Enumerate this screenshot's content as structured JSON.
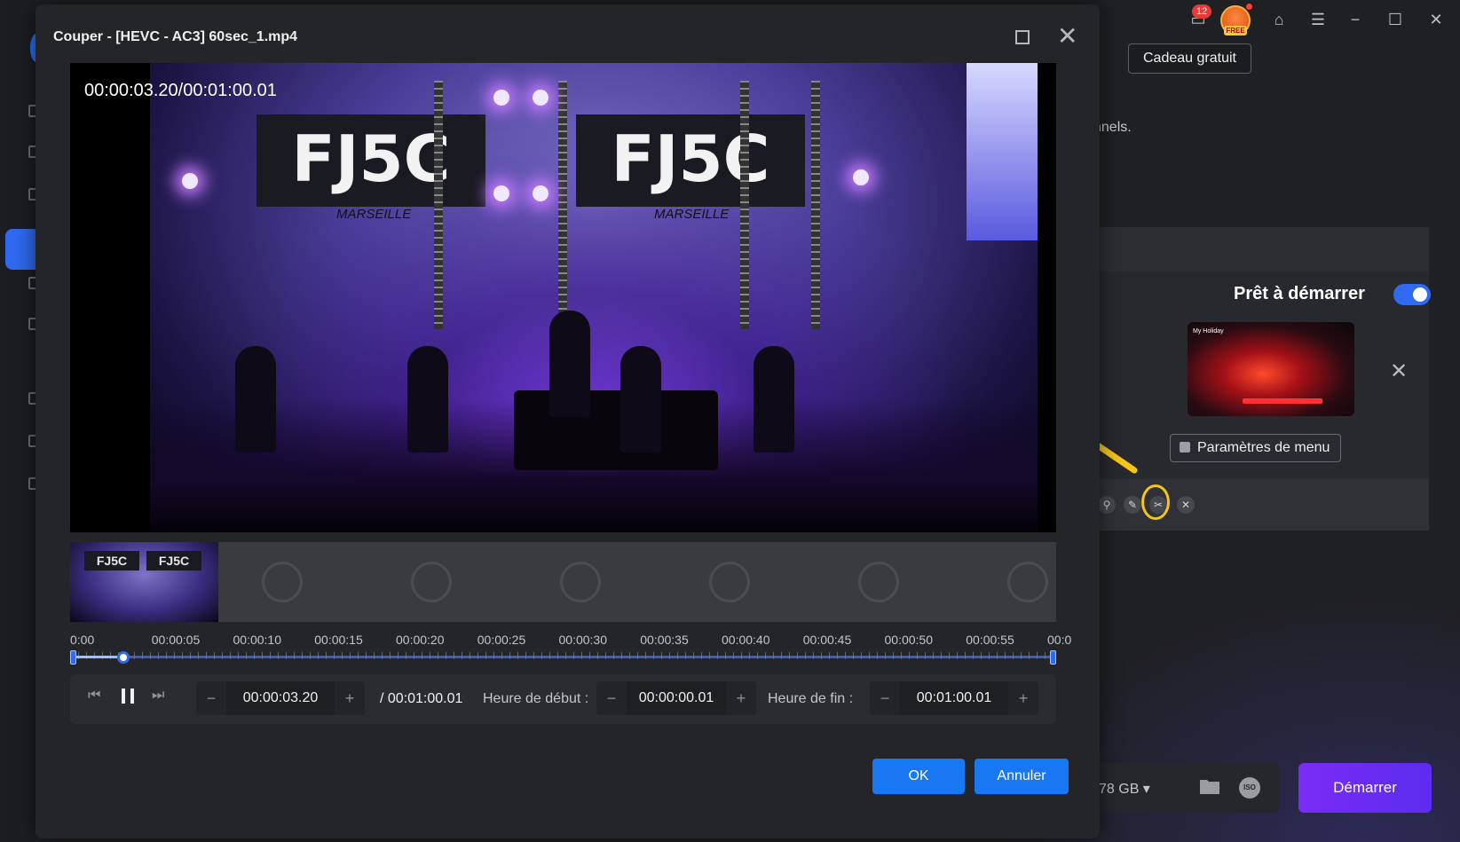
{
  "background_app": {
    "notification_count": "12",
    "gift_badge": "FREE",
    "free_gift_button": "Cadeau gratuit",
    "partial_text": "nnels.",
    "ready_label": "Prêt à démarrer",
    "ready_toggle_on": true,
    "menu_thumbnail_title": "My Holiday",
    "menu_settings_button": "Paramètres de menu",
    "disk_size": "78 GB",
    "iso_label": "ISO",
    "start_button": "Démarrer",
    "accent_color": "#2f6af0",
    "start_gradient": [
      "#7a2cf5",
      "#5b2cf0"
    ],
    "highlight_color": "#f5c518"
  },
  "dialog": {
    "title": "Couper - [HEVC - AC3] 60sec_1.mp4",
    "video_timecode": "00:00:03.20/00:01:00.01",
    "banner_text": "FJ5C",
    "banner_subtext": "MARSEILLE",
    "thumbnail_banner": "FJ5C",
    "timeline_ticks": [
      "0:00",
      "00:00:05",
      "00:00:10",
      "00:00:15",
      "00:00:20",
      "00:00:25",
      "00:00:30",
      "00:00:35",
      "00:00:40",
      "00:00:45",
      "00:00:50",
      "00:00:55",
      "00:0"
    ],
    "playhead_position": 0.054,
    "controls": {
      "current_time": "00:00:03.20",
      "total_duration": "/ 00:01:00.01",
      "start_label": "Heure de début :",
      "start_time": "00:00:00.01",
      "end_label": "Heure de fin :",
      "end_time": "00:01:00.01",
      "minus": "−",
      "plus": "+"
    },
    "ok_button": "OK",
    "cancel_button": "Annuler"
  }
}
